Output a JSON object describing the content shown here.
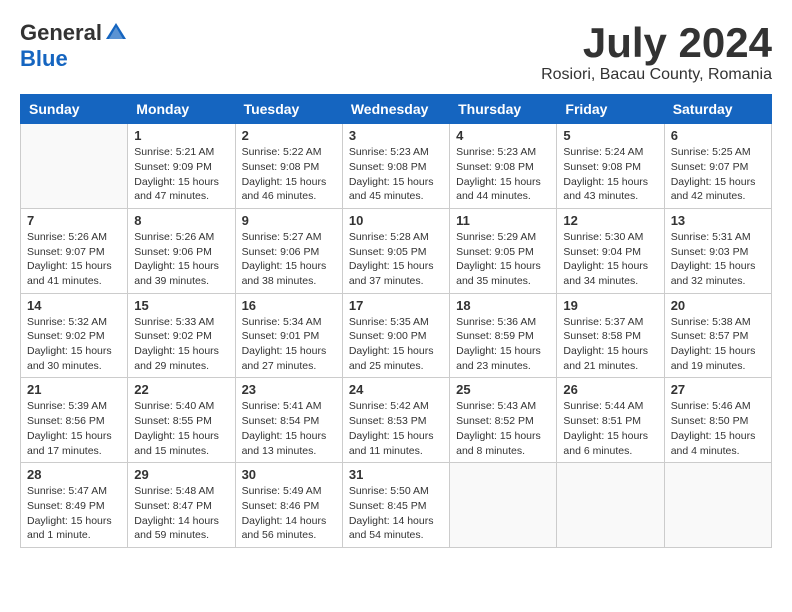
{
  "logo": {
    "general": "General",
    "blue": "Blue"
  },
  "title": {
    "month_year": "July 2024",
    "location": "Rosiori, Bacau County, Romania"
  },
  "headers": [
    "Sunday",
    "Monday",
    "Tuesday",
    "Wednesday",
    "Thursday",
    "Friday",
    "Saturday"
  ],
  "weeks": [
    [
      {
        "day": "",
        "info": ""
      },
      {
        "day": "1",
        "info": "Sunrise: 5:21 AM\nSunset: 9:09 PM\nDaylight: 15 hours\nand 47 minutes."
      },
      {
        "day": "2",
        "info": "Sunrise: 5:22 AM\nSunset: 9:08 PM\nDaylight: 15 hours\nand 46 minutes."
      },
      {
        "day": "3",
        "info": "Sunrise: 5:23 AM\nSunset: 9:08 PM\nDaylight: 15 hours\nand 45 minutes."
      },
      {
        "day": "4",
        "info": "Sunrise: 5:23 AM\nSunset: 9:08 PM\nDaylight: 15 hours\nand 44 minutes."
      },
      {
        "day": "5",
        "info": "Sunrise: 5:24 AM\nSunset: 9:08 PM\nDaylight: 15 hours\nand 43 minutes."
      },
      {
        "day": "6",
        "info": "Sunrise: 5:25 AM\nSunset: 9:07 PM\nDaylight: 15 hours\nand 42 minutes."
      }
    ],
    [
      {
        "day": "7",
        "info": "Sunrise: 5:26 AM\nSunset: 9:07 PM\nDaylight: 15 hours\nand 41 minutes."
      },
      {
        "day": "8",
        "info": "Sunrise: 5:26 AM\nSunset: 9:06 PM\nDaylight: 15 hours\nand 39 minutes."
      },
      {
        "day": "9",
        "info": "Sunrise: 5:27 AM\nSunset: 9:06 PM\nDaylight: 15 hours\nand 38 minutes."
      },
      {
        "day": "10",
        "info": "Sunrise: 5:28 AM\nSunset: 9:05 PM\nDaylight: 15 hours\nand 37 minutes."
      },
      {
        "day": "11",
        "info": "Sunrise: 5:29 AM\nSunset: 9:05 PM\nDaylight: 15 hours\nand 35 minutes."
      },
      {
        "day": "12",
        "info": "Sunrise: 5:30 AM\nSunset: 9:04 PM\nDaylight: 15 hours\nand 34 minutes."
      },
      {
        "day": "13",
        "info": "Sunrise: 5:31 AM\nSunset: 9:03 PM\nDaylight: 15 hours\nand 32 minutes."
      }
    ],
    [
      {
        "day": "14",
        "info": "Sunrise: 5:32 AM\nSunset: 9:02 PM\nDaylight: 15 hours\nand 30 minutes."
      },
      {
        "day": "15",
        "info": "Sunrise: 5:33 AM\nSunset: 9:02 PM\nDaylight: 15 hours\nand 29 minutes."
      },
      {
        "day": "16",
        "info": "Sunrise: 5:34 AM\nSunset: 9:01 PM\nDaylight: 15 hours\nand 27 minutes."
      },
      {
        "day": "17",
        "info": "Sunrise: 5:35 AM\nSunset: 9:00 PM\nDaylight: 15 hours\nand 25 minutes."
      },
      {
        "day": "18",
        "info": "Sunrise: 5:36 AM\nSunset: 8:59 PM\nDaylight: 15 hours\nand 23 minutes."
      },
      {
        "day": "19",
        "info": "Sunrise: 5:37 AM\nSunset: 8:58 PM\nDaylight: 15 hours\nand 21 minutes."
      },
      {
        "day": "20",
        "info": "Sunrise: 5:38 AM\nSunset: 8:57 PM\nDaylight: 15 hours\nand 19 minutes."
      }
    ],
    [
      {
        "day": "21",
        "info": "Sunrise: 5:39 AM\nSunset: 8:56 PM\nDaylight: 15 hours\nand 17 minutes."
      },
      {
        "day": "22",
        "info": "Sunrise: 5:40 AM\nSunset: 8:55 PM\nDaylight: 15 hours\nand 15 minutes."
      },
      {
        "day": "23",
        "info": "Sunrise: 5:41 AM\nSunset: 8:54 PM\nDaylight: 15 hours\nand 13 minutes."
      },
      {
        "day": "24",
        "info": "Sunrise: 5:42 AM\nSunset: 8:53 PM\nDaylight: 15 hours\nand 11 minutes."
      },
      {
        "day": "25",
        "info": "Sunrise: 5:43 AM\nSunset: 8:52 PM\nDaylight: 15 hours\nand 8 minutes."
      },
      {
        "day": "26",
        "info": "Sunrise: 5:44 AM\nSunset: 8:51 PM\nDaylight: 15 hours\nand 6 minutes."
      },
      {
        "day": "27",
        "info": "Sunrise: 5:46 AM\nSunset: 8:50 PM\nDaylight: 15 hours\nand 4 minutes."
      }
    ],
    [
      {
        "day": "28",
        "info": "Sunrise: 5:47 AM\nSunset: 8:49 PM\nDaylight: 15 hours\nand 1 minute."
      },
      {
        "day": "29",
        "info": "Sunrise: 5:48 AM\nSunset: 8:47 PM\nDaylight: 14 hours\nand 59 minutes."
      },
      {
        "day": "30",
        "info": "Sunrise: 5:49 AM\nSunset: 8:46 PM\nDaylight: 14 hours\nand 56 minutes."
      },
      {
        "day": "31",
        "info": "Sunrise: 5:50 AM\nSunset: 8:45 PM\nDaylight: 14 hours\nand 54 minutes."
      },
      {
        "day": "",
        "info": ""
      },
      {
        "day": "",
        "info": ""
      },
      {
        "day": "",
        "info": ""
      }
    ]
  ]
}
